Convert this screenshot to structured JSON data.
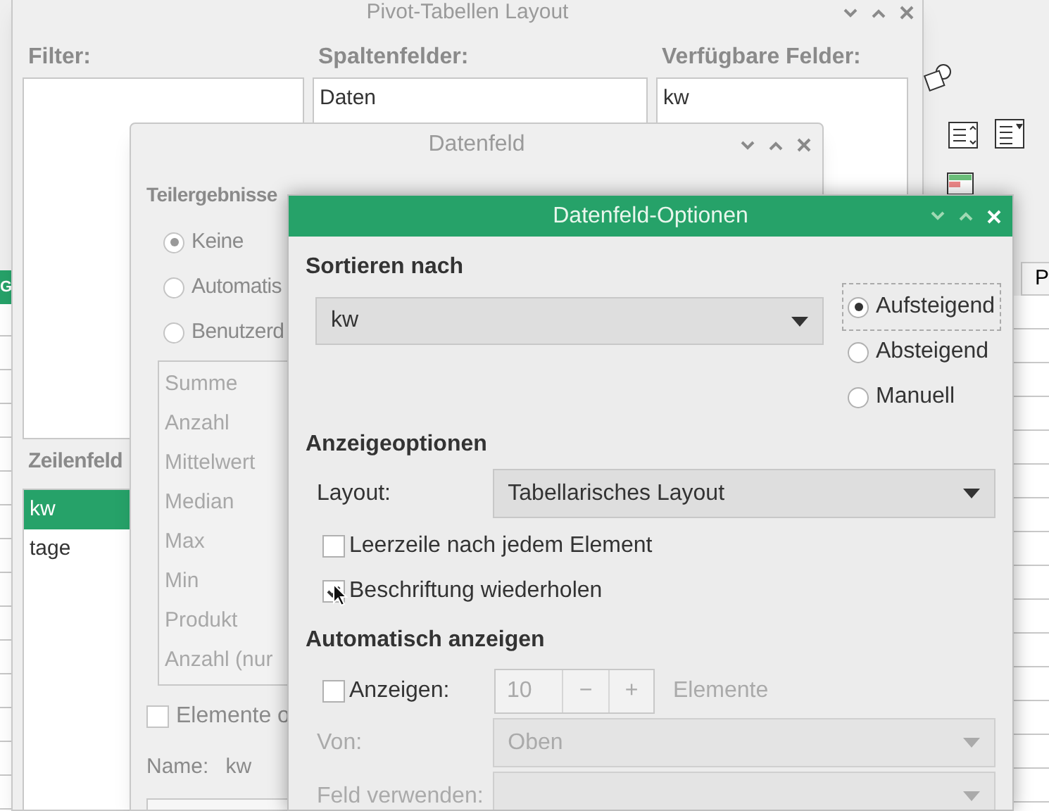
{
  "spreadsheet": {
    "left_column_header": "G",
    "right_column_header": "P"
  },
  "pivot_layout": {
    "title": "Pivot-Tabellen Layout",
    "filter_label": "Filter:",
    "column_fields_label": "Spaltenfelder:",
    "column_fields": [
      "Daten"
    ],
    "available_label": "Verfügbare Felder:",
    "available_fields": [
      "kw"
    ],
    "row_fields_label": "Zeilenfeld",
    "row_fields": [
      {
        "label": "kw",
        "selected": true
      },
      {
        "label": "tage",
        "selected": false
      }
    ]
  },
  "data_field": {
    "title": "Datenfeld",
    "subtotals_label": "Teilergebnisse",
    "subtotal_options": [
      {
        "label": "Keine",
        "selected": true
      },
      {
        "label": "Automatis",
        "selected": false
      },
      {
        "label": "Benutzerd",
        "selected": false
      }
    ],
    "functions_disabled": true,
    "functions": [
      "Summe",
      "Anzahl",
      "Mittelwert",
      "Median",
      "Max",
      "Min",
      "Produkt",
      "Anzahl (nur"
    ],
    "show_items": {
      "label": "Elemente o",
      "checked": false
    },
    "name_label": "Name:",
    "name": "kw"
  },
  "options": {
    "title": "Datenfeld-Optionen",
    "sort_label": "Sortieren nach",
    "sort_field": "kw",
    "sort_orders": [
      {
        "label": "Aufsteigend",
        "selected": true
      },
      {
        "label": "Absteigend",
        "selected": false
      },
      {
        "label": "Manuell",
        "selected": false
      }
    ],
    "display_label": "Anzeigeoptionen",
    "layout_label": "Layout:",
    "layout_value": "Tabellarisches Layout",
    "display_checks": [
      {
        "label": "Leerzeile nach jedem Element",
        "checked": false
      },
      {
        "label": "Beschriftung wiederholen",
        "checked": true
      }
    ],
    "auto_label": "Automatisch anzeigen",
    "show_check": {
      "label": "Anzeigen:",
      "checked": false
    },
    "spinner": {
      "value": "10",
      "minus": "−",
      "plus": "+",
      "disabled": true
    },
    "items_label": "Elemente",
    "from": {
      "label": "Von:",
      "value": "Oben",
      "disabled": true
    },
    "use_field": {
      "label": "Feld verwenden:",
      "disabled": true
    }
  }
}
